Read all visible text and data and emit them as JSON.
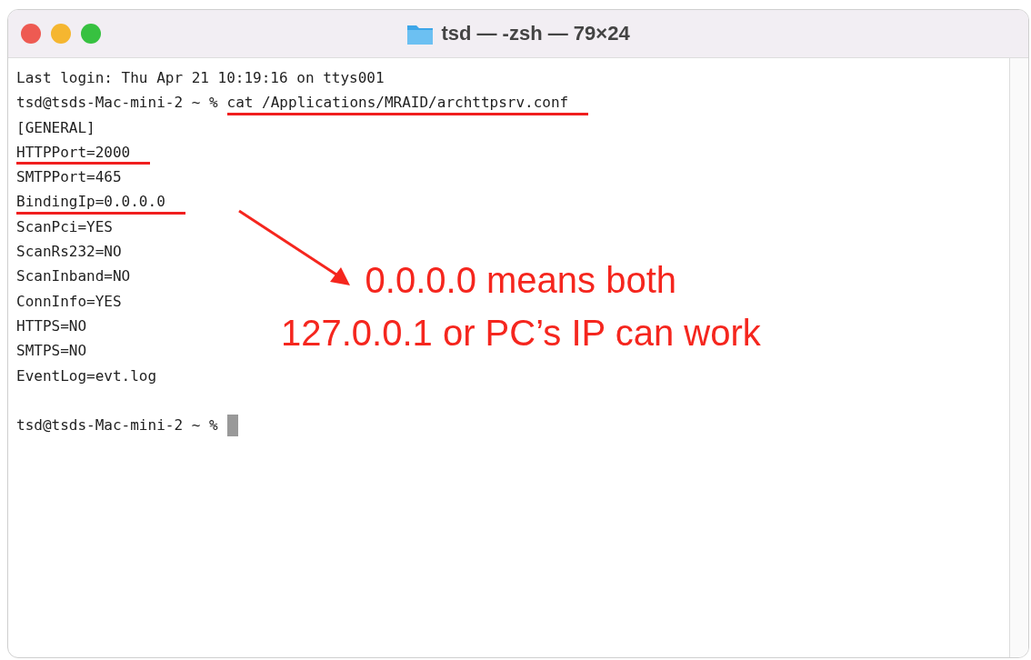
{
  "window": {
    "title": "tsd — -zsh — 79×24"
  },
  "lines": [
    {
      "kind": "output",
      "text": "Last login: Thu Apr 21 10:19:16 on ttys001",
      "underlined": false
    },
    {
      "kind": "command",
      "prompt": "tsd@tsds-Mac-mini-2 ~ %",
      "text": "cat /Applications/MRAID/archttpsrv.conf",
      "underlined": true
    },
    {
      "kind": "output",
      "text": "[GENERAL]",
      "underlined": false
    },
    {
      "kind": "output",
      "text": "HTTPPort=2000",
      "underlined": true
    },
    {
      "kind": "output",
      "text": "SMTPPort=465",
      "underlined": false
    },
    {
      "kind": "output",
      "text": "BindingIp=0.0.0.0",
      "underlined": true
    },
    {
      "kind": "output",
      "text": "ScanPci=YES",
      "underlined": false
    },
    {
      "kind": "output",
      "text": "ScanRs232=NO",
      "underlined": false
    },
    {
      "kind": "output",
      "text": "ScanInband=NO",
      "underlined": false
    },
    {
      "kind": "output",
      "text": "ConnInfo=YES",
      "underlined": false
    },
    {
      "kind": "output",
      "text": "HTTPS=NO",
      "underlined": false
    },
    {
      "kind": "output",
      "text": "SMTPS=NO",
      "underlined": false
    },
    {
      "kind": "output",
      "text": "EventLog=evt.log",
      "underlined": false
    },
    {
      "kind": "blank"
    },
    {
      "kind": "prompt",
      "prompt": "tsd@tsds-Mac-mini-2 ~ %"
    }
  ],
  "annotation": {
    "lines": [
      "0.0.0.0 means both",
      "127.0.0.1 or PC’s IP can work"
    ]
  }
}
